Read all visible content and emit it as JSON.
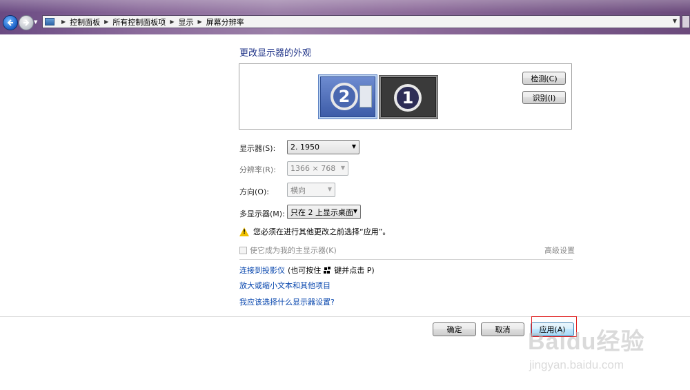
{
  "address_bar": {
    "breadcrumbs": [
      "控制面板",
      "所有控制面板项",
      "显示",
      "屏幕分辨率"
    ]
  },
  "page": {
    "title": "更改显示器的外观"
  },
  "preview": {
    "monitors": [
      {
        "number": "2",
        "selected": true
      },
      {
        "number": "1",
        "selected": false
      }
    ],
    "detect_label": "检测(C)",
    "identify_label": "识别(I)"
  },
  "settings": {
    "display": {
      "label": "显示器(S):",
      "value": "2. 1950",
      "enabled": true
    },
    "resolution": {
      "label": "分辨率(R):",
      "value": "1366 × 768",
      "enabled": false
    },
    "orientation": {
      "label": "方向(O):",
      "value": "横向",
      "enabled": false
    },
    "multi_display": {
      "label": "多显示器(M):",
      "value": "只在 2 上显示桌面",
      "enabled": true
    }
  },
  "warning": {
    "text": "您必须在进行其他更改之前选择“应用”。"
  },
  "main_display_checkbox": {
    "label": "使它成为我的主显示器(K)",
    "checked": false,
    "enabled": false
  },
  "advanced_link": "高级设置",
  "links": {
    "projector": "连接到投影仪",
    "projector_hint_prefix": "(也可按住",
    "projector_hint_suffix": "键并点击 P)",
    "text_size": "放大或缩小文本和其他项目",
    "which_settings": "我应该选择什么显示器设置?"
  },
  "buttons": {
    "ok": "确定",
    "cancel": "取消",
    "apply": "应用(A)"
  },
  "watermark": {
    "brand": "Baidu经验",
    "url": "jingyan.baidu.com"
  },
  "colors": {
    "title": "#1e3287",
    "link": "#0645ad",
    "highlight_box": "#e02020"
  }
}
